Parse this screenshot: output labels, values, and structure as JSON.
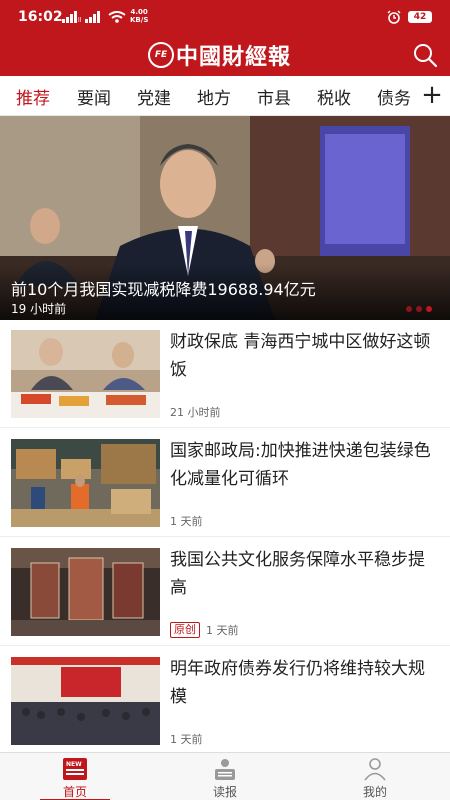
{
  "status_bar": {
    "time": "16:02",
    "speed_value": "4.00",
    "speed_unit": "KB/S",
    "battery": "42"
  },
  "header": {
    "logo_badge": "FE",
    "logo_text": "中國財經報"
  },
  "tabs": [
    {
      "label": "推荐",
      "active": true
    },
    {
      "label": "要闻",
      "active": false
    },
    {
      "label": "党建",
      "active": false
    },
    {
      "label": "地方",
      "active": false
    },
    {
      "label": "市县",
      "active": false
    },
    {
      "label": "税收",
      "active": false
    },
    {
      "label": "债务",
      "active": false
    }
  ],
  "tab_more": "+",
  "hero": {
    "title": "前10个月我国实现减税降费19688.94亿元",
    "time": "19 小时前"
  },
  "news": [
    {
      "title": "财政保底 青海西宁城中区做好这顿饭",
      "time": "21 小时前",
      "badge": ""
    },
    {
      "title": "国家邮政局:加快推进快递包装绿色化减量化可循环",
      "time": "1 天前",
      "badge": ""
    },
    {
      "title": "我国公共文化服务保障水平稳步提高",
      "time": "1 天前",
      "badge": "原创"
    },
    {
      "title": "明年政府债券发行仍将维持较大规模",
      "time": "1 天前",
      "badge": ""
    }
  ],
  "bottom_nav": [
    {
      "label": "首页",
      "icon": "news-home-icon",
      "active": true
    },
    {
      "label": "读报",
      "icon": "reader-icon",
      "active": false
    },
    {
      "label": "我的",
      "icon": "profile-icon",
      "active": false
    }
  ],
  "colors": {
    "brand_red": "#c0171d",
    "text": "#222222",
    "meta": "#666666"
  }
}
